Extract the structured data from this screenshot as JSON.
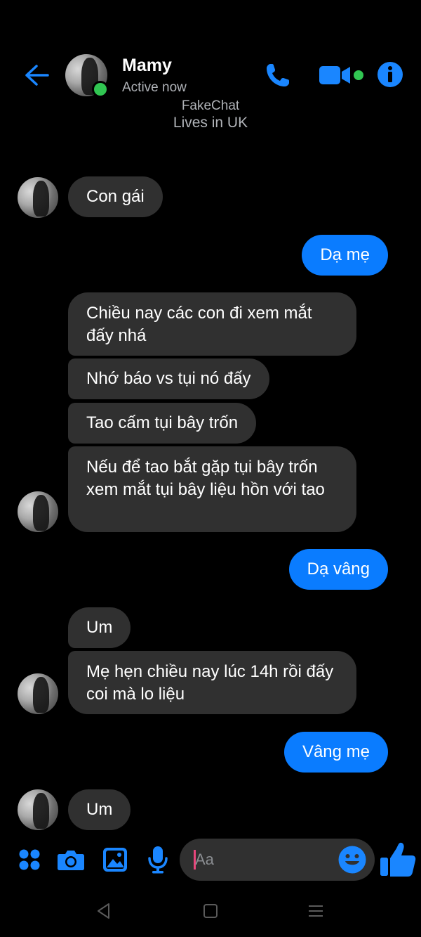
{
  "header": {
    "contact_name": "Mamy",
    "status": "Active now",
    "subtitle_line_1": "FakeChat",
    "subtitle_line_2": "Lives in UK",
    "icons": {
      "back": "back-arrow-icon",
      "call": "phone-icon",
      "video": "video-camera-icon",
      "info": "info-icon"
    }
  },
  "messages": [
    {
      "from": "them",
      "text": "Con gái"
    },
    {
      "from": "me",
      "text": "Dạ mẹ"
    },
    {
      "from": "them",
      "text": "Chiều nay các con đi xem mắt đấy nhá"
    },
    {
      "from": "them",
      "text": "Nhớ báo vs tụi nó đấy"
    },
    {
      "from": "them",
      "text": "Tao cấm tụi bây trốn"
    },
    {
      "from": "them",
      "text": "Nếu để tao bắt gặp tụi bây trốn xem mắt tụi bây liệu hồn với tao"
    },
    {
      "from": "me",
      "text": "Dạ vâng"
    },
    {
      "from": "them",
      "text": "Um"
    },
    {
      "from": "them",
      "text": "Mẹ hẹn chiều nay lúc 14h rồi đấy coi mà lo liệu"
    },
    {
      "from": "me",
      "text": "Vâng mẹ"
    },
    {
      "from": "them",
      "text": "Um"
    }
  ],
  "composer": {
    "placeholder": "Aa",
    "icons": [
      "menu-grid-icon",
      "camera-icon",
      "gallery-icon",
      "microphone-icon",
      "emoji-icon",
      "thumbs-up-icon"
    ]
  },
  "system_nav": {
    "icons": [
      "nav-back-icon",
      "nav-home-icon",
      "nav-recents-icon"
    ]
  },
  "colors": {
    "background": "#000000",
    "incoming_bubble": "#303030",
    "outgoing_bubble": "#0a7cff",
    "accent": "#0a7cff",
    "online": "#31c652"
  }
}
